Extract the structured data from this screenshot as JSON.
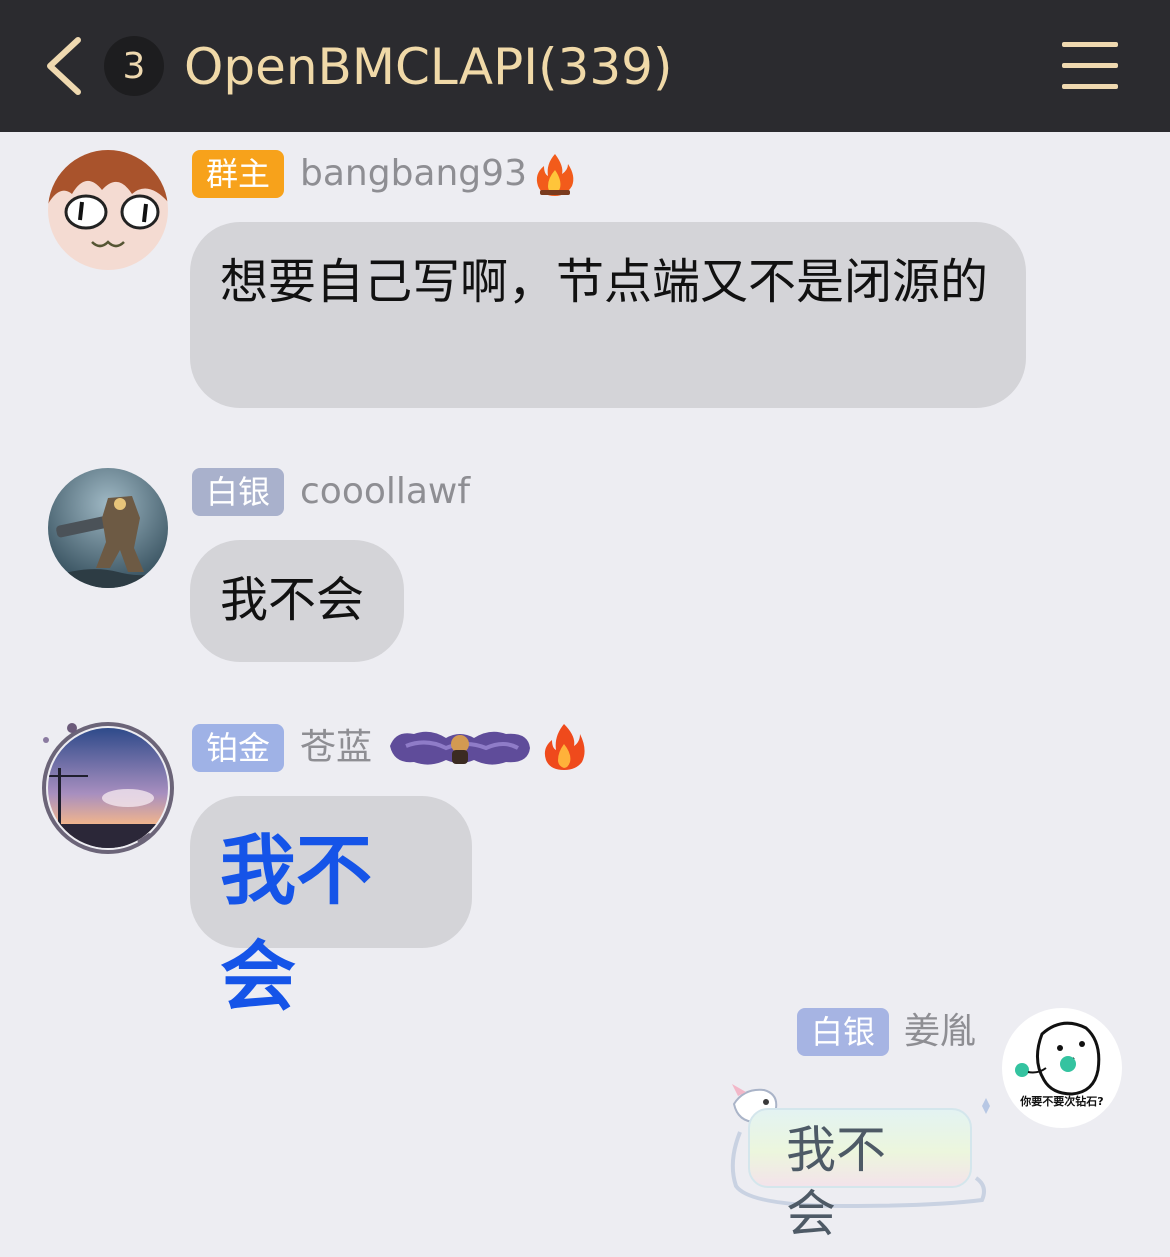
{
  "header": {
    "unread_count": "3",
    "title": "OpenBMCLAPI(339)",
    "background": "#2b2b2f",
    "accent": "#f0d9a8"
  },
  "messages": [
    {
      "badge": "群主",
      "badge_color": "#f7a21b",
      "name": "bangbang93",
      "name_icon": "fire-icon",
      "text": "想要自己写啊，节点端又不是闭源的"
    },
    {
      "badge": "白银",
      "badge_color": "#a9b1cc",
      "name": "cooollawf",
      "text": "我不会"
    },
    {
      "badge": "铂金",
      "badge_color": "#9fb2e6",
      "name": "苍蓝",
      "name_icon": "fire-icon",
      "text": "我不会",
      "text_color": "#1554e8"
    },
    {
      "badge": "白银",
      "badge_color": "#a6b4e3",
      "name": "姜胤",
      "text": "我不会",
      "own": true,
      "avatar_caption": "你要不要次钻石?"
    }
  ]
}
